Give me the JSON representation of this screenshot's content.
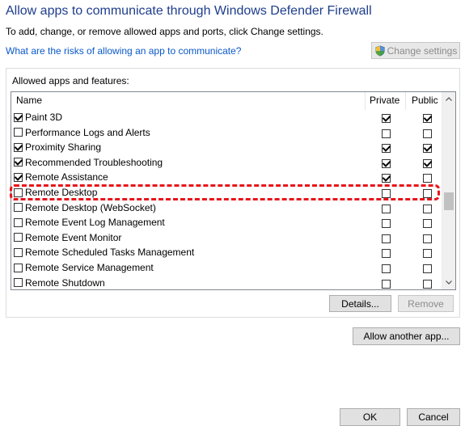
{
  "header": {
    "title": "Allow apps to communicate through Windows Defender Firewall",
    "subtitle": "To add, change, or remove allowed apps and ports, click Change settings.",
    "risk_link": "What are the risks of allowing an app to communicate?",
    "change_settings_label": "Change settings"
  },
  "allowed": {
    "group_label": "Allowed apps and features:",
    "columns": {
      "name": "Name",
      "private": "Private",
      "public": "Public"
    },
    "rows": [
      {
        "name": "Paint 3D",
        "enabled": true,
        "private": true,
        "public": true
      },
      {
        "name": "Performance Logs and Alerts",
        "enabled": false,
        "private": false,
        "public": false
      },
      {
        "name": "Proximity Sharing",
        "enabled": true,
        "private": true,
        "public": true
      },
      {
        "name": "Recommended Troubleshooting",
        "enabled": true,
        "private": true,
        "public": true
      },
      {
        "name": "Remote Assistance",
        "enabled": true,
        "private": true,
        "public": false
      },
      {
        "name": "Remote Desktop",
        "enabled": false,
        "private": false,
        "public": false
      },
      {
        "name": "Remote Desktop (WebSocket)",
        "enabled": false,
        "private": false,
        "public": false
      },
      {
        "name": "Remote Event Log Management",
        "enabled": false,
        "private": false,
        "public": false
      },
      {
        "name": "Remote Event Monitor",
        "enabled": false,
        "private": false,
        "public": false
      },
      {
        "name": "Remote Scheduled Tasks Management",
        "enabled": false,
        "private": false,
        "public": false
      },
      {
        "name": "Remote Service Management",
        "enabled": false,
        "private": false,
        "public": false
      },
      {
        "name": "Remote Shutdown",
        "enabled": false,
        "private": false,
        "public": false
      }
    ],
    "details_label": "Details...",
    "remove_label": "Remove"
  },
  "footer": {
    "allow_another_label": "Allow another app...",
    "ok_label": "OK",
    "cancel_label": "Cancel"
  },
  "colors": {
    "title": "#1e3d8c",
    "link": "#0a58c8",
    "highlight": "#e8141b"
  },
  "icons": {
    "change_settings": "shield-icon",
    "scroll_up": "chevron-up-icon",
    "scroll_down": "chevron-down-icon"
  }
}
